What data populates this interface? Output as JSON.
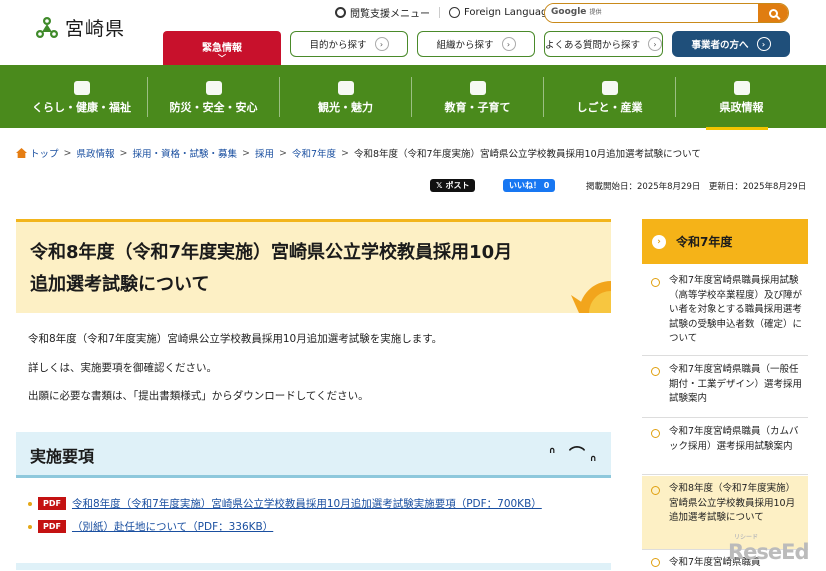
{
  "header": {
    "logo_text": "宮崎県",
    "accessibility_menu": "閲覧支援メニュー",
    "foreign_language": "Foreign Language",
    "search_brand": "Google",
    "search_suffix": "提供",
    "emergency": "緊急情報",
    "buttons": [
      "目的から探す",
      "組織から探す",
      "よくある質問から探す",
      "事業者の方へ"
    ]
  },
  "nav": {
    "items": [
      "くらし・健康・福祉",
      "防災・安全・安心",
      "観光・魅力",
      "教育・子育て",
      "しごと・産業",
      "県政情報"
    ],
    "active": "県政情報"
  },
  "breadcrumb": {
    "links": [
      "トップ",
      "県政情報",
      "採用・資格・試験・募集",
      "採用",
      "令和7年度"
    ],
    "current": "令和8年度（令和7年度実施）宮崎県公立学校教員採用10月追加選考試験について"
  },
  "share": {
    "x_post": "ポスト",
    "fb_like": "いいね！ 0"
  },
  "dates": "掲載開始日：2025年8月29日　更新日：2025年8月29日",
  "page": {
    "title_line1": "令和8年度（令和7年度実施）宮崎県公立学校教員採用10月",
    "title_line2": "追加選考試験について",
    "paragraphs": [
      "令和8年度（令和7年度実施）宮崎県公立学校教員採用10月追加選考試験を実施します。",
      "詳しくは、実施要項を御確認ください。",
      "出願に必要な書類は、「提出書類様式」からダウンロードしてください。"
    ],
    "section_heading": "実施要項",
    "documents": [
      {
        "badge": "PDF",
        "label": "令和8年度（令和7年度実施）宮崎県公立学校教員採用10月追加選考試験実施要項（PDF：700KB）"
      },
      {
        "badge": "PDF",
        "label": "（別紙）赴任地について（PDF：336KB）"
      }
    ]
  },
  "sidebar": {
    "heading": "令和7年度",
    "items": [
      "令和7年度宮崎県職員採用試験（高等学校卒業程度）及び障がい者を対象とする職員採用選考試験の受験申込者数（確定）について",
      "令和7年度宮崎県職員（一般任期付・工業デザイン）選考採用試験案内",
      "令和7年度宮崎県職員（カムバック採用）選考採用試験案内",
      "令和8年度（令和7年度実施）宮崎県公立学校教員採用10月追加選考試験について",
      "令和7年度宮崎県職員"
    ]
  },
  "watermark": {
    "text": "ReseEd",
    "small": "リシード"
  },
  "colors": {
    "green": "#4a8a1c",
    "orange": "#e07d10",
    "red": "#c8112c",
    "navy": "#1f4f7a",
    "yellow": "#f5b318"
  }
}
